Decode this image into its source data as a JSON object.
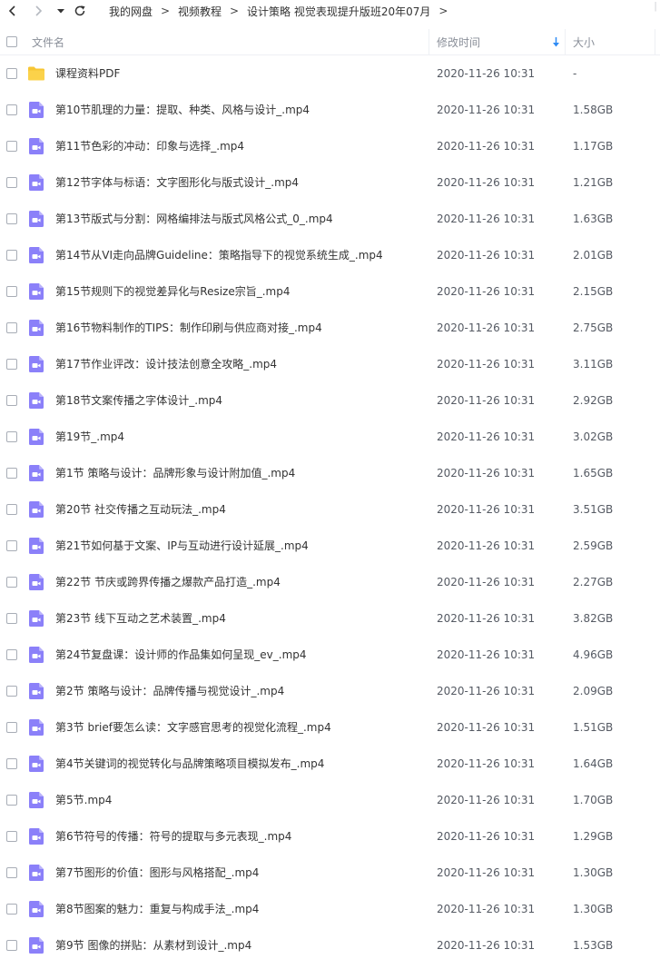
{
  "toolbar": {
    "back_icon": "chevron-left-icon",
    "forward_icon": "chevron-right-icon",
    "history_icon": "caret-down-icon",
    "refresh_icon": "refresh-icon"
  },
  "breadcrumb": {
    "items": [
      "我的网盘",
      "视频教程",
      "设计策略 视觉表现提升版班20年07月"
    ],
    "separator": ">",
    "trailing_separator": ">"
  },
  "columns": {
    "name": "文件名",
    "mtime": "修改时间",
    "size": "大小",
    "sort_icon": "sort-down-arrow-icon"
  },
  "colors": {
    "folder": "#f7c634",
    "video": "#8b80f9",
    "sort_arrow": "#2f8cf5"
  },
  "files": [
    {
      "name": "课程资料PDF",
      "mtime": "2020-11-26 10:31",
      "size": "-",
      "type": "folder"
    },
    {
      "name": "第10节肌理的力量：提取、种类、风格与设计_.mp4",
      "mtime": "2020-11-26 10:31",
      "size": "1.58GB",
      "type": "video"
    },
    {
      "name": "第11节色彩的冲动：印象与选择_.mp4",
      "mtime": "2020-11-26 10:31",
      "size": "1.17GB",
      "type": "video"
    },
    {
      "name": "第12节字体与标语：文字图形化与版式设计_.mp4",
      "mtime": "2020-11-26 10:31",
      "size": "1.21GB",
      "type": "video"
    },
    {
      "name": "第13节版式与分割：网格编排法与版式风格公式_0_.mp4",
      "mtime": "2020-11-26 10:31",
      "size": "1.63GB",
      "type": "video"
    },
    {
      "name": "第14节从VI走向品牌Guideline：策略指导下的视觉系统生成_.mp4",
      "mtime": "2020-11-26 10:31",
      "size": "2.01GB",
      "type": "video"
    },
    {
      "name": "第15节规则下的视觉差异化与Resize宗旨_.mp4",
      "mtime": "2020-11-26 10:31",
      "size": "2.15GB",
      "type": "video"
    },
    {
      "name": "第16节物料制作的TIPS：制作印刷与供应商对接_.mp4",
      "mtime": "2020-11-26 10:31",
      "size": "2.75GB",
      "type": "video"
    },
    {
      "name": "第17节作业评改：设计技法创意全攻略_.mp4",
      "mtime": "2020-11-26 10:31",
      "size": "3.11GB",
      "type": "video"
    },
    {
      "name": "第18节文案传播之字体设计_.mp4",
      "mtime": "2020-11-26 10:31",
      "size": "2.92GB",
      "type": "video"
    },
    {
      "name": "第19节_.mp4",
      "mtime": "2020-11-26 10:31",
      "size": "3.02GB",
      "type": "video"
    },
    {
      "name": "第1节 策略与设计：品牌形象与设计附加值_.mp4",
      "mtime": "2020-11-26 10:31",
      "size": "1.65GB",
      "type": "video"
    },
    {
      "name": "第20节 社交传播之互动玩法_.mp4",
      "mtime": "2020-11-26 10:31",
      "size": "3.51GB",
      "type": "video"
    },
    {
      "name": "第21节如何基于文案、IP与互动进行设计延展_.mp4",
      "mtime": "2020-11-26 10:31",
      "size": "2.59GB",
      "type": "video"
    },
    {
      "name": "第22节 节庆或跨界传播之爆款产品打造_.mp4",
      "mtime": "2020-11-26 10:31",
      "size": "2.27GB",
      "type": "video"
    },
    {
      "name": "第23节 线下互动之艺术装置_.mp4",
      "mtime": "2020-11-26 10:31",
      "size": "3.82GB",
      "type": "video"
    },
    {
      "name": "第24节复盘课：设计师的作品集如何呈现_ev_.mp4",
      "mtime": "2020-11-26 10:31",
      "size": "4.96GB",
      "type": "video"
    },
    {
      "name": "第2节 策略与设计：品牌传播与视觉设计_.mp4",
      "mtime": "2020-11-26 10:31",
      "size": "2.09GB",
      "type": "video"
    },
    {
      "name": "第3节 brief要怎么读：文字感官思考的视觉化流程_.mp4",
      "mtime": "2020-11-26 10:31",
      "size": "1.51GB",
      "type": "video"
    },
    {
      "name": "第4节关键词的视觉转化与品牌策略项目模拟发布_.mp4",
      "mtime": "2020-11-26 10:31",
      "size": "1.64GB",
      "type": "video"
    },
    {
      "name": "第5节.mp4",
      "mtime": "2020-11-26 10:31",
      "size": "1.70GB",
      "type": "video"
    },
    {
      "name": "第6节符号的传播：符号的提取与多元表现_.mp4",
      "mtime": "2020-11-26 10:31",
      "size": "1.29GB",
      "type": "video"
    },
    {
      "name": "第7节图形的价值：图形与风格搭配_.mp4",
      "mtime": "2020-11-26 10:31",
      "size": "1.30GB",
      "type": "video"
    },
    {
      "name": "第8节图案的魅力：重复与构成手法_.mp4",
      "mtime": "2020-11-26 10:31",
      "size": "1.30GB",
      "type": "video"
    },
    {
      "name": "第9节 图像的拼贴：从素材到设计_.mp4",
      "mtime": "2020-11-26 10:31",
      "size": "1.53GB",
      "type": "video"
    }
  ]
}
